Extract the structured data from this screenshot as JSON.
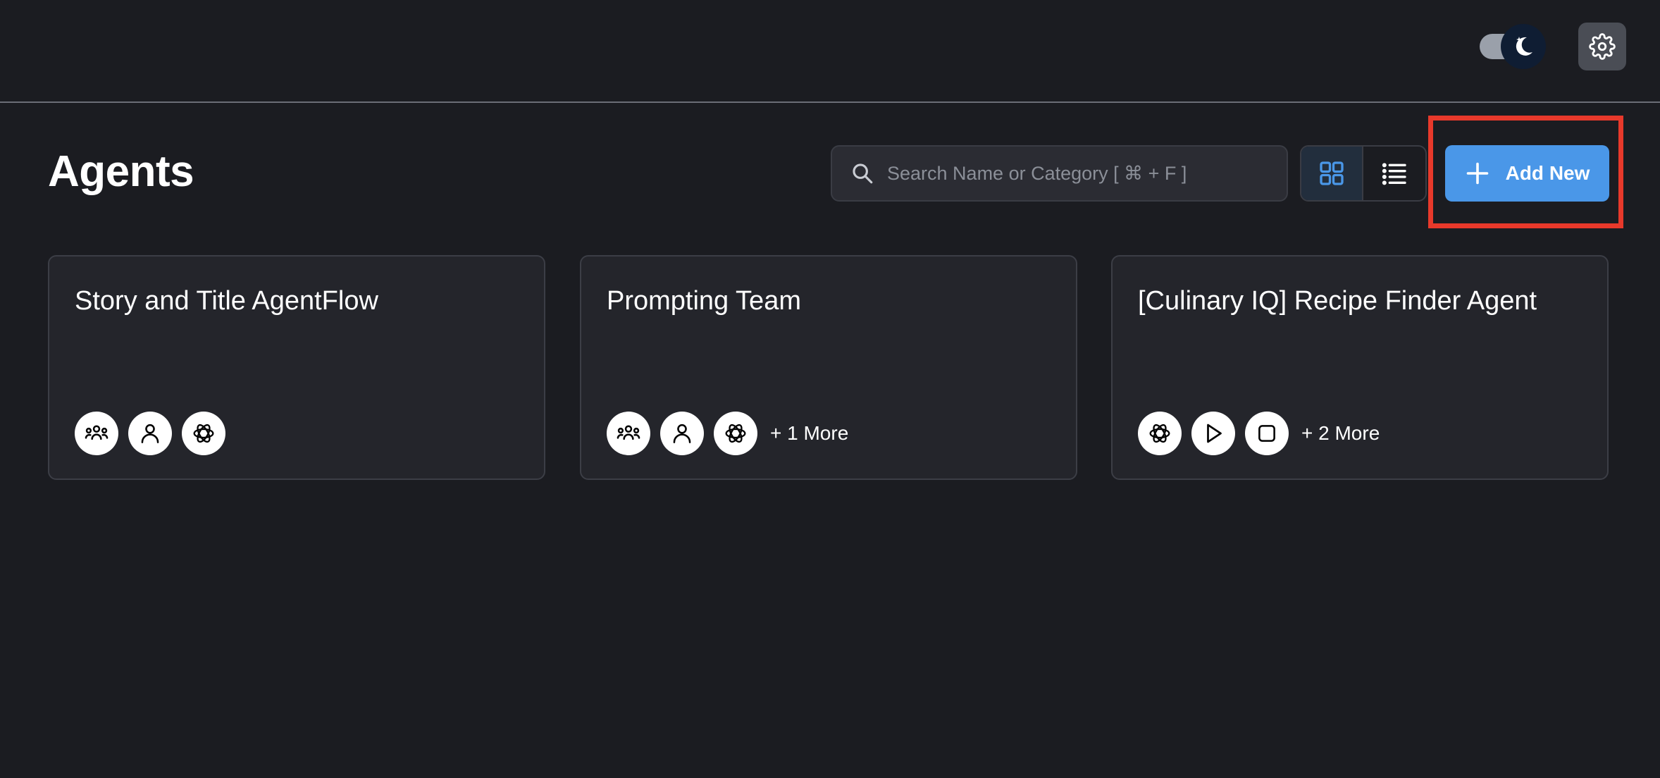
{
  "header": {
    "theme_toggle_icon": "moon-icon",
    "settings_icon": "gear-icon"
  },
  "page": {
    "title": "Agents"
  },
  "toolbar": {
    "search_placeholder": "Search Name or Category [ ⌘ + F ]",
    "search_value": "",
    "view_modes": [
      "grid",
      "list"
    ],
    "active_view": "grid",
    "add_new_label": "Add New"
  },
  "colors": {
    "background": "#1b1c21",
    "card": "#24252b",
    "accent": "#4a97e8",
    "highlight": "#e8392b"
  },
  "cards": [
    {
      "title": "Story and Title AgentFlow",
      "icons": [
        "team-icon",
        "person-icon",
        "openai-icon"
      ],
      "more": ""
    },
    {
      "title": "Prompting Team",
      "icons": [
        "team-icon",
        "person-icon",
        "openai-icon"
      ],
      "more": "+ 1 More"
    },
    {
      "title": "[Culinary IQ] Recipe Finder Agent",
      "icons": [
        "openai-icon",
        "play-icon",
        "stop-icon"
      ],
      "more": "+ 2 More"
    }
  ]
}
